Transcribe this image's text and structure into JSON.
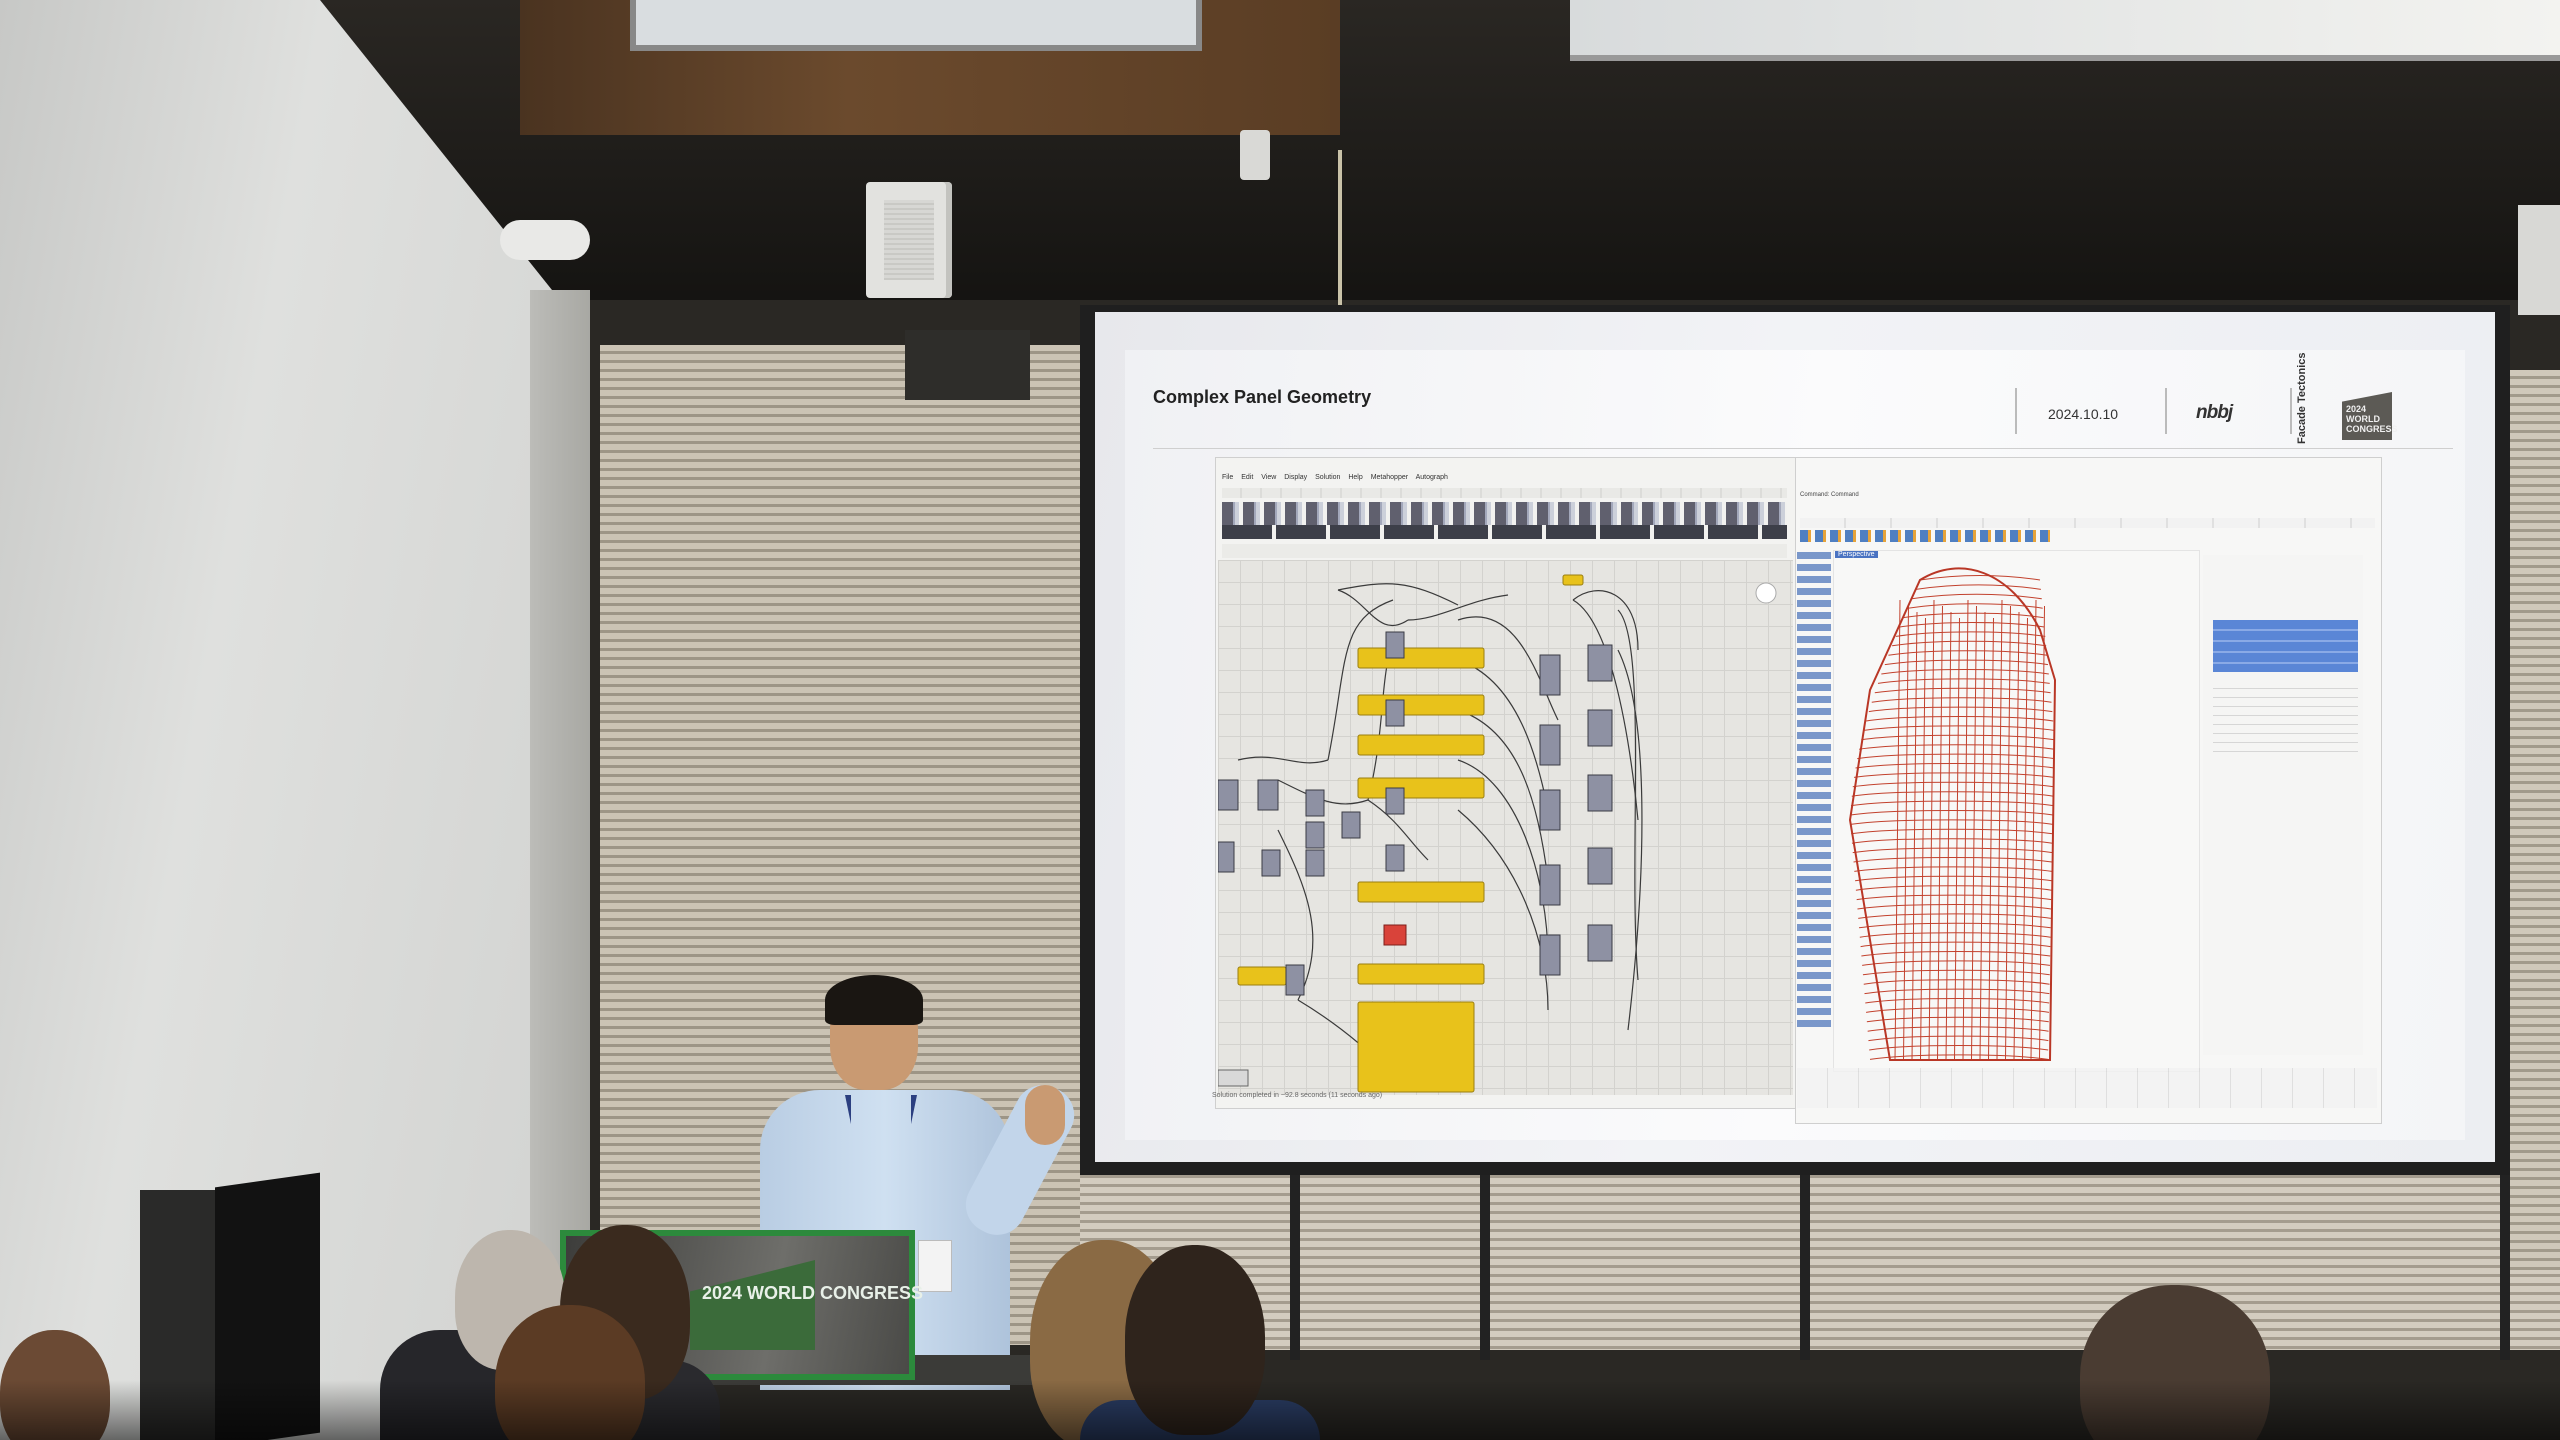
{
  "slide": {
    "title": "Complex Panel Geometry",
    "date": "2024.10.10",
    "brand": "nbbj",
    "event_logo": {
      "side_text": "Facade Tectonics",
      "text": "2024 WORLD CONGRESS"
    }
  },
  "podium_sign": {
    "text": "2024 WORLD CONGRESS"
  },
  "grasshopper": {
    "menu": "File Edit View Display Solution Help Metahopper Autograph",
    "status": "Solution completed in ~92.8 seconds (11 seconds ago)"
  },
  "rhino": {
    "command_line": "Command: Command",
    "viewport_label": "Perspective"
  },
  "colors": {
    "gh_component": "#e8c21b",
    "rhino_geometry": "#c2412d",
    "rhino_layer_highlight": "#4a73c2",
    "podium_green": "#2c8a3c"
  }
}
